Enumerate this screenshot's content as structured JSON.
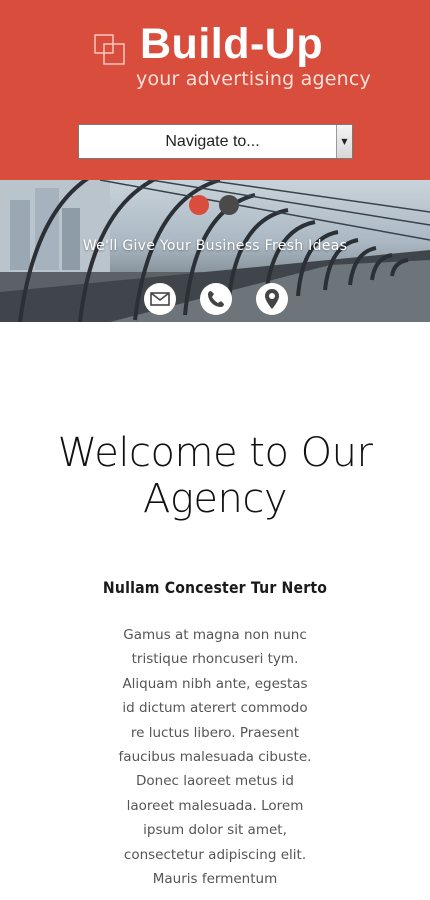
{
  "brand": {
    "name": "Build-Up",
    "tagline": "your advertising agency",
    "logo_mark_icon": "overlapping-squares-icon",
    "header_color": "#d94d3c"
  },
  "nav": {
    "select_value": "Navigate to..."
  },
  "hero": {
    "caption": "We'll Give Your Business Fresh Ideas",
    "slides": [
      "slide-1",
      "slide-2"
    ],
    "active_slide": 1,
    "contact_icons": [
      "envelope-icon",
      "phone-icon",
      "map-pin-icon"
    ]
  },
  "main": {
    "heading": "Welcome to Our Agency",
    "subtitle": "Nullam Concester Tur Nerto",
    "body": "Gamus at magna non nunc tristique rhoncuseri tym. Aliquam nibh ante, egestas id dictum aterert commodo re luctus libero. Praesent faucibus malesuada cibuste. Donec laoreet metus id laoreet malesuada. Lorem ipsum dolor sit amet, consectetur adipiscing elit. Mauris fermentum"
  }
}
